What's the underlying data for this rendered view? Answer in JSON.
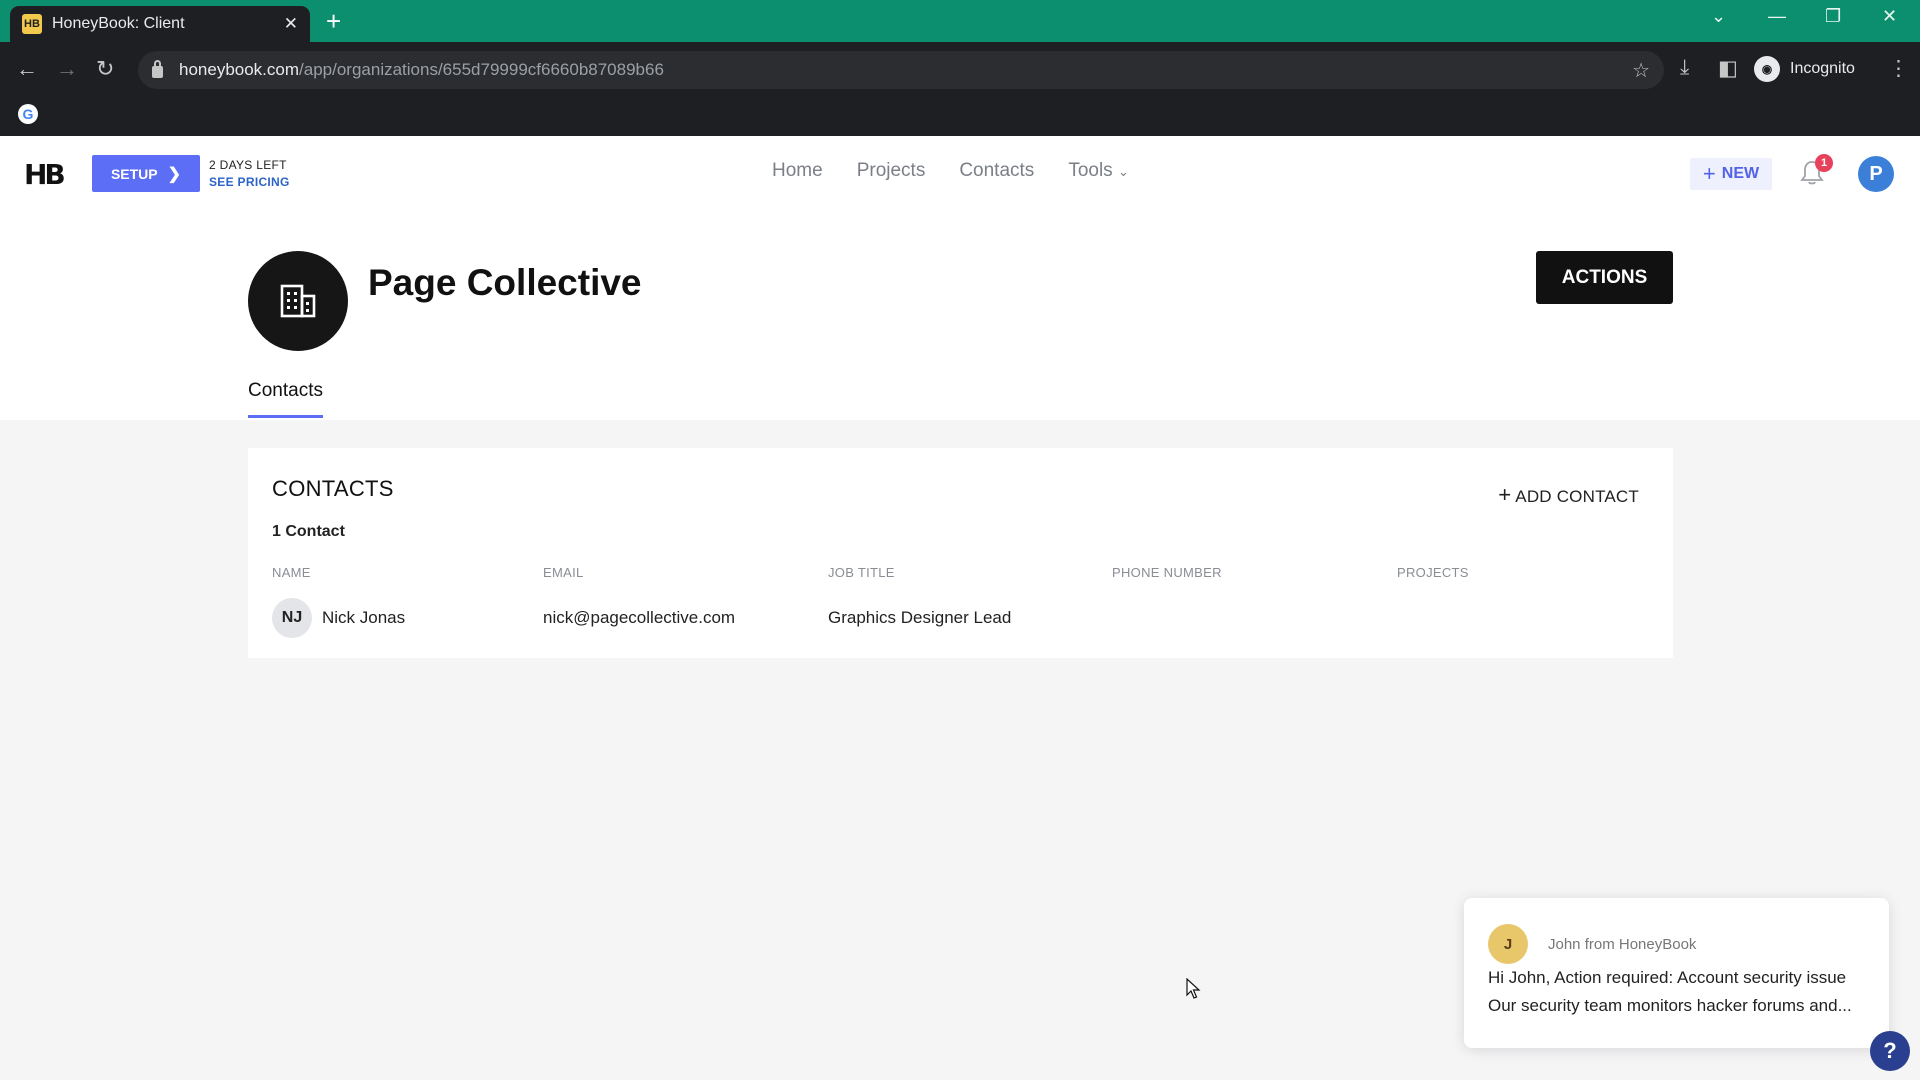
{
  "browser": {
    "tab_title": "HoneyBook: Client",
    "favicon_text": "HB",
    "url_domain": "honeybook.com",
    "url_path": "/app/organizations/655d79999cf6660b87089b66",
    "profile_label": "Incognito"
  },
  "app": {
    "logo_text": "HB",
    "setup_label": "SETUP",
    "days_left": "2 DAYS LEFT",
    "see_pricing": "SEE PRICING",
    "nav": [
      "Home",
      "Projects",
      "Contacts",
      "Tools"
    ],
    "new_label": "NEW",
    "notification_count": "1",
    "user_initial": "P"
  },
  "organization": {
    "name": "Page Collective",
    "actions_label": "ACTIONS",
    "tab_label": "Contacts"
  },
  "contacts": {
    "title": "CONTACTS",
    "add_label": "ADD CONTACT",
    "count_label": "1 Contact",
    "columns": [
      "NAME",
      "EMAIL",
      "JOB TITLE",
      "PHONE NUMBER",
      "PROJECTS"
    ],
    "rows": [
      {
        "initials": "NJ",
        "name": "Nick Jonas",
        "email": "nick@pagecollective.com",
        "job_title": "Graphics Designer Lead",
        "phone": "",
        "projects": ""
      }
    ]
  },
  "chat": {
    "from": "John from HoneyBook",
    "line1": "Hi John, Action required: Account security issue",
    "line2": "Our security team monitors hacker forums and..."
  },
  "colors": {
    "accent": "#5b6ef5",
    "chrome_green": "#0c8f6e",
    "badge_red": "#e8415b"
  }
}
